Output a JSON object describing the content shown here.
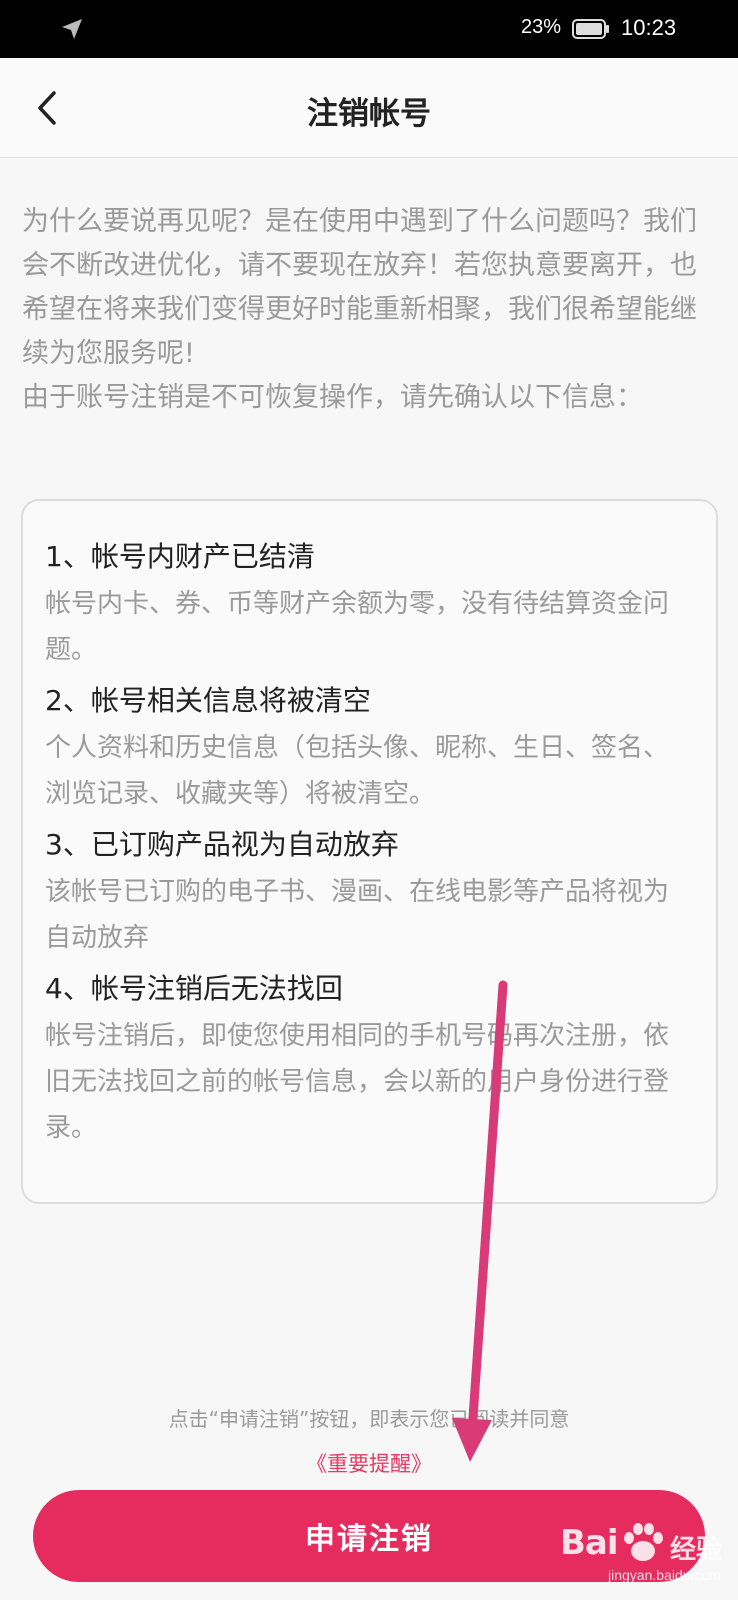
{
  "status_bar": {
    "battery_percent": "23%",
    "time": "10:23"
  },
  "header": {
    "title": "注销帐号",
    "back_icon": "chevron-left-icon"
  },
  "intro": {
    "paragraph1": "为什么要说再见呢？是在使用中遇到了什么问题吗？我们会不断改进优化，请不要现在放弃！若您执意要离开，也希望在将来我们变得更好时能重新相聚，我们很希望能继续为您服务呢!",
    "paragraph2": "由于账号注销是不可恢复操作，请先确认以下信息："
  },
  "info_items": [
    {
      "title": "1、帐号内财产已结清",
      "desc": "帐号内卡、券、币等财产余额为零，没有待结算资金问题。"
    },
    {
      "title": "2、帐号相关信息将被清空",
      "desc": "个人资料和历史信息（包括头像、昵称、生日、签名、浏览记录、收藏夹等）将被清空。"
    },
    {
      "title": "3、已订购产品视为自动放弃",
      "desc": "该帐号已订购的电子书、漫画、在线电影等产品将视为自动放弃"
    },
    {
      "title": "4、帐号注销后无法找回",
      "desc": "帐号注销后，即使您使用相同的手机号码再次注册，依旧无法找回之前的帐号信息，会以新的用户身份进行登录。"
    }
  ],
  "agreement": {
    "text": "点击“申请注销”按钮，即表示您已阅读并同意",
    "link": "《重要提醒》"
  },
  "apply_button": {
    "label": "申请注销"
  },
  "watermark": {
    "brand": "Bai",
    "brand_suffix": "经验",
    "url": "jingyan.baidu.com"
  },
  "colors": {
    "accent": "#e62b5f",
    "arrow": "#d93a78"
  }
}
